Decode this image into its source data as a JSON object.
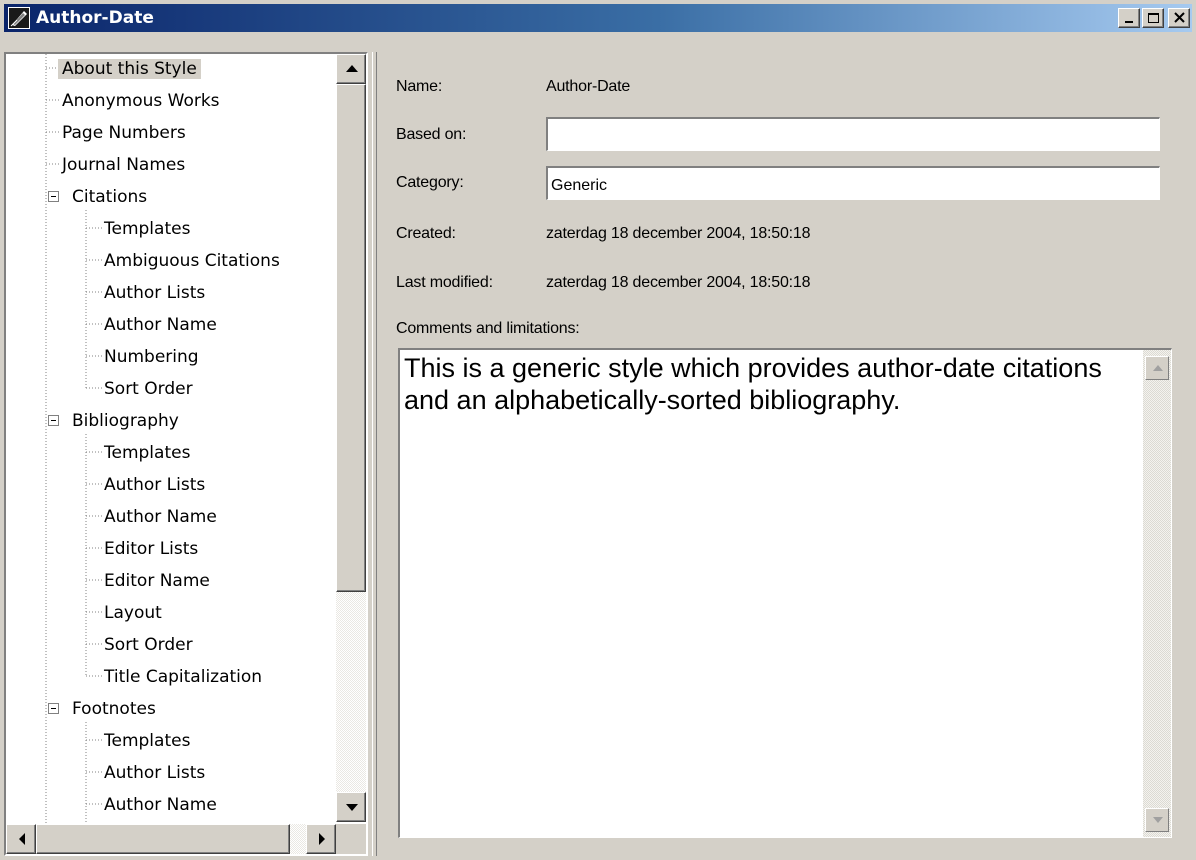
{
  "window": {
    "title": "Author-Date",
    "controls": {
      "minimize": "minimize",
      "maximize": "maximize",
      "close": "close"
    }
  },
  "tree": {
    "items": [
      {
        "label": "About this Style",
        "level": 1,
        "selected": true
      },
      {
        "label": "Anonymous Works",
        "level": 1
      },
      {
        "label": "Page Numbers",
        "level": 1
      },
      {
        "label": "Journal Names",
        "level": 1
      },
      {
        "label": "Citations",
        "level": 0,
        "expanded": true
      },
      {
        "label": "Templates",
        "level": 2
      },
      {
        "label": "Ambiguous Citations",
        "level": 2
      },
      {
        "label": "Author Lists",
        "level": 2
      },
      {
        "label": "Author Name",
        "level": 2
      },
      {
        "label": "Numbering",
        "level": 2
      },
      {
        "label": "Sort Order",
        "level": 2
      },
      {
        "label": "Bibliography",
        "level": 0,
        "expanded": true
      },
      {
        "label": "Templates",
        "level": 2
      },
      {
        "label": "Author Lists",
        "level": 2
      },
      {
        "label": "Author Name",
        "level": 2
      },
      {
        "label": "Editor Lists",
        "level": 2
      },
      {
        "label": "Editor Name",
        "level": 2
      },
      {
        "label": "Layout",
        "level": 2
      },
      {
        "label": "Sort Order",
        "level": 2
      },
      {
        "label": "Title Capitalization",
        "level": 2
      },
      {
        "label": "Footnotes",
        "level": 0,
        "expanded": true
      },
      {
        "label": "Templates",
        "level": 2
      },
      {
        "label": "Author Lists",
        "level": 2
      },
      {
        "label": "Author Name",
        "level": 2
      }
    ]
  },
  "details": {
    "name_label": "Name:",
    "name_value": "Author-Date",
    "based_on_label": "Based on:",
    "based_on_value": "",
    "category_label": "Category:",
    "category_value": "Generic",
    "created_label": "Created:",
    "created_value": "zaterdag 18 december 2004, 18:50:18",
    "modified_label": "Last modified:",
    "modified_value": "zaterdag 18 december 2004, 18:50:18",
    "comments_label": "Comments and limitations:",
    "comments_value": "This is a generic style which provides author-date citations and an alphabetically-sorted bibliography."
  },
  "colors": {
    "titlebar_start": "#0a246a",
    "titlebar_end": "#a6caf0",
    "face": "#d4d0c8",
    "selection_bg": "#d4d0c8"
  },
  "icons": {
    "app": "style-icon",
    "scroll_up": "arrow-up-icon",
    "scroll_down": "arrow-down-icon",
    "scroll_left": "arrow-left-icon",
    "scroll_right": "arrow-right-icon",
    "expander": "collapse-icon"
  }
}
